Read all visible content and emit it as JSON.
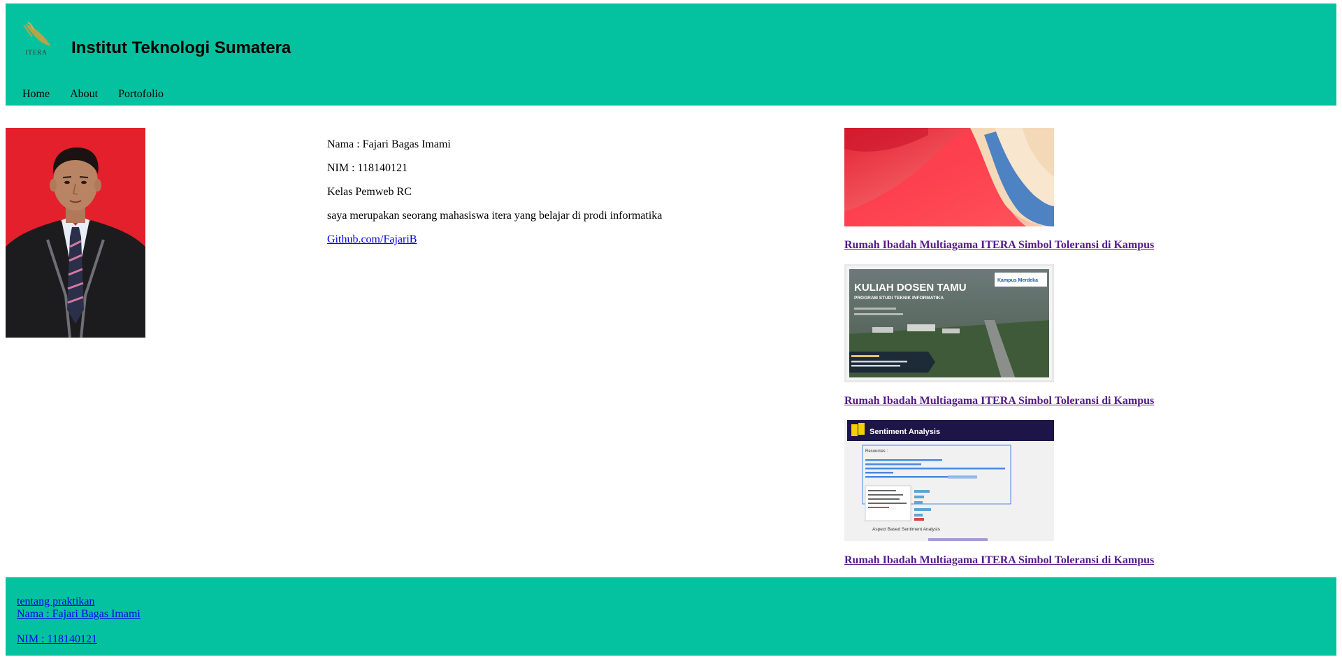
{
  "header": {
    "logo_text": "ITERA",
    "title": "Institut Teknologi Sumatera",
    "nav": [
      {
        "label": "Home"
      },
      {
        "label": "About"
      },
      {
        "label": "Portofolio"
      }
    ]
  },
  "profile": {
    "name": "Nama : Fajari Bagas Imami",
    "nim": "NIM : 118140121",
    "kelas": "Kelas Pemweb RC",
    "description": "saya merupakan seorang mahasiswa itera yang belajar di prodi informatika",
    "github": "Github.com/FajariB"
  },
  "gallery": [
    {
      "link": "Rumah Ibadah Multiagama ITERA Simbol Toleransi di Kampus"
    },
    {
      "link": "Rumah Ibadah Multiagama ITERA Simbol Toleransi di Kampus",
      "poster_title": "KULIAH DOSEN TAMU",
      "poster_subtitle": "PROGRAM STUDI TEKNIK INFORMATIKA",
      "poster_badge": "Kampus Merdeka"
    },
    {
      "link": "Rumah Ibadah Multiagama ITERA Simbol Toleransi di Kampus",
      "slide_title": "Sentiment Analysis",
      "slide_resources": "Resources :",
      "slide_caption": "Aspect Based Sentiment Analysis"
    }
  ],
  "footer": {
    "about_link": "tentang praktikan",
    "name_link": "Nama : Fajari Bagas Imami",
    "nim_link": "NIM : 118140121"
  },
  "colors": {
    "header_bg": "#04c29f",
    "footer_bg": "#04c29f",
    "link": "#0000ee",
    "visited_link": "#551a8b"
  }
}
